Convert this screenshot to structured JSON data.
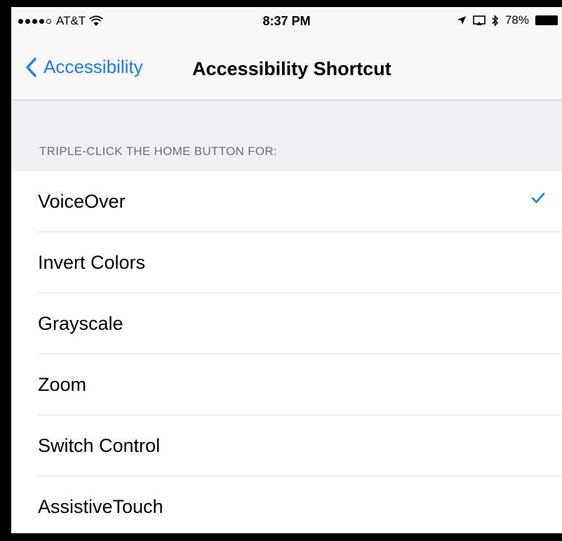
{
  "status_bar": {
    "carrier": "AT&T",
    "time": "8:37 PM",
    "battery": "78%"
  },
  "nav": {
    "back_label": "Accessibility",
    "title": "Accessibility Shortcut"
  },
  "section": {
    "header": "TRIPLE-CLICK THE HOME BUTTON FOR:"
  },
  "options": [
    {
      "label": "VoiceOver",
      "checked": true
    },
    {
      "label": "Invert Colors",
      "checked": false
    },
    {
      "label": "Grayscale",
      "checked": false
    },
    {
      "label": "Zoom",
      "checked": false
    },
    {
      "label": "Switch Control",
      "checked": false
    },
    {
      "label": "AssistiveTouch",
      "checked": false
    }
  ],
  "colors": {
    "accent": "#1a7cf5",
    "background": "#efeff4",
    "bar": "#f7f7f7"
  }
}
